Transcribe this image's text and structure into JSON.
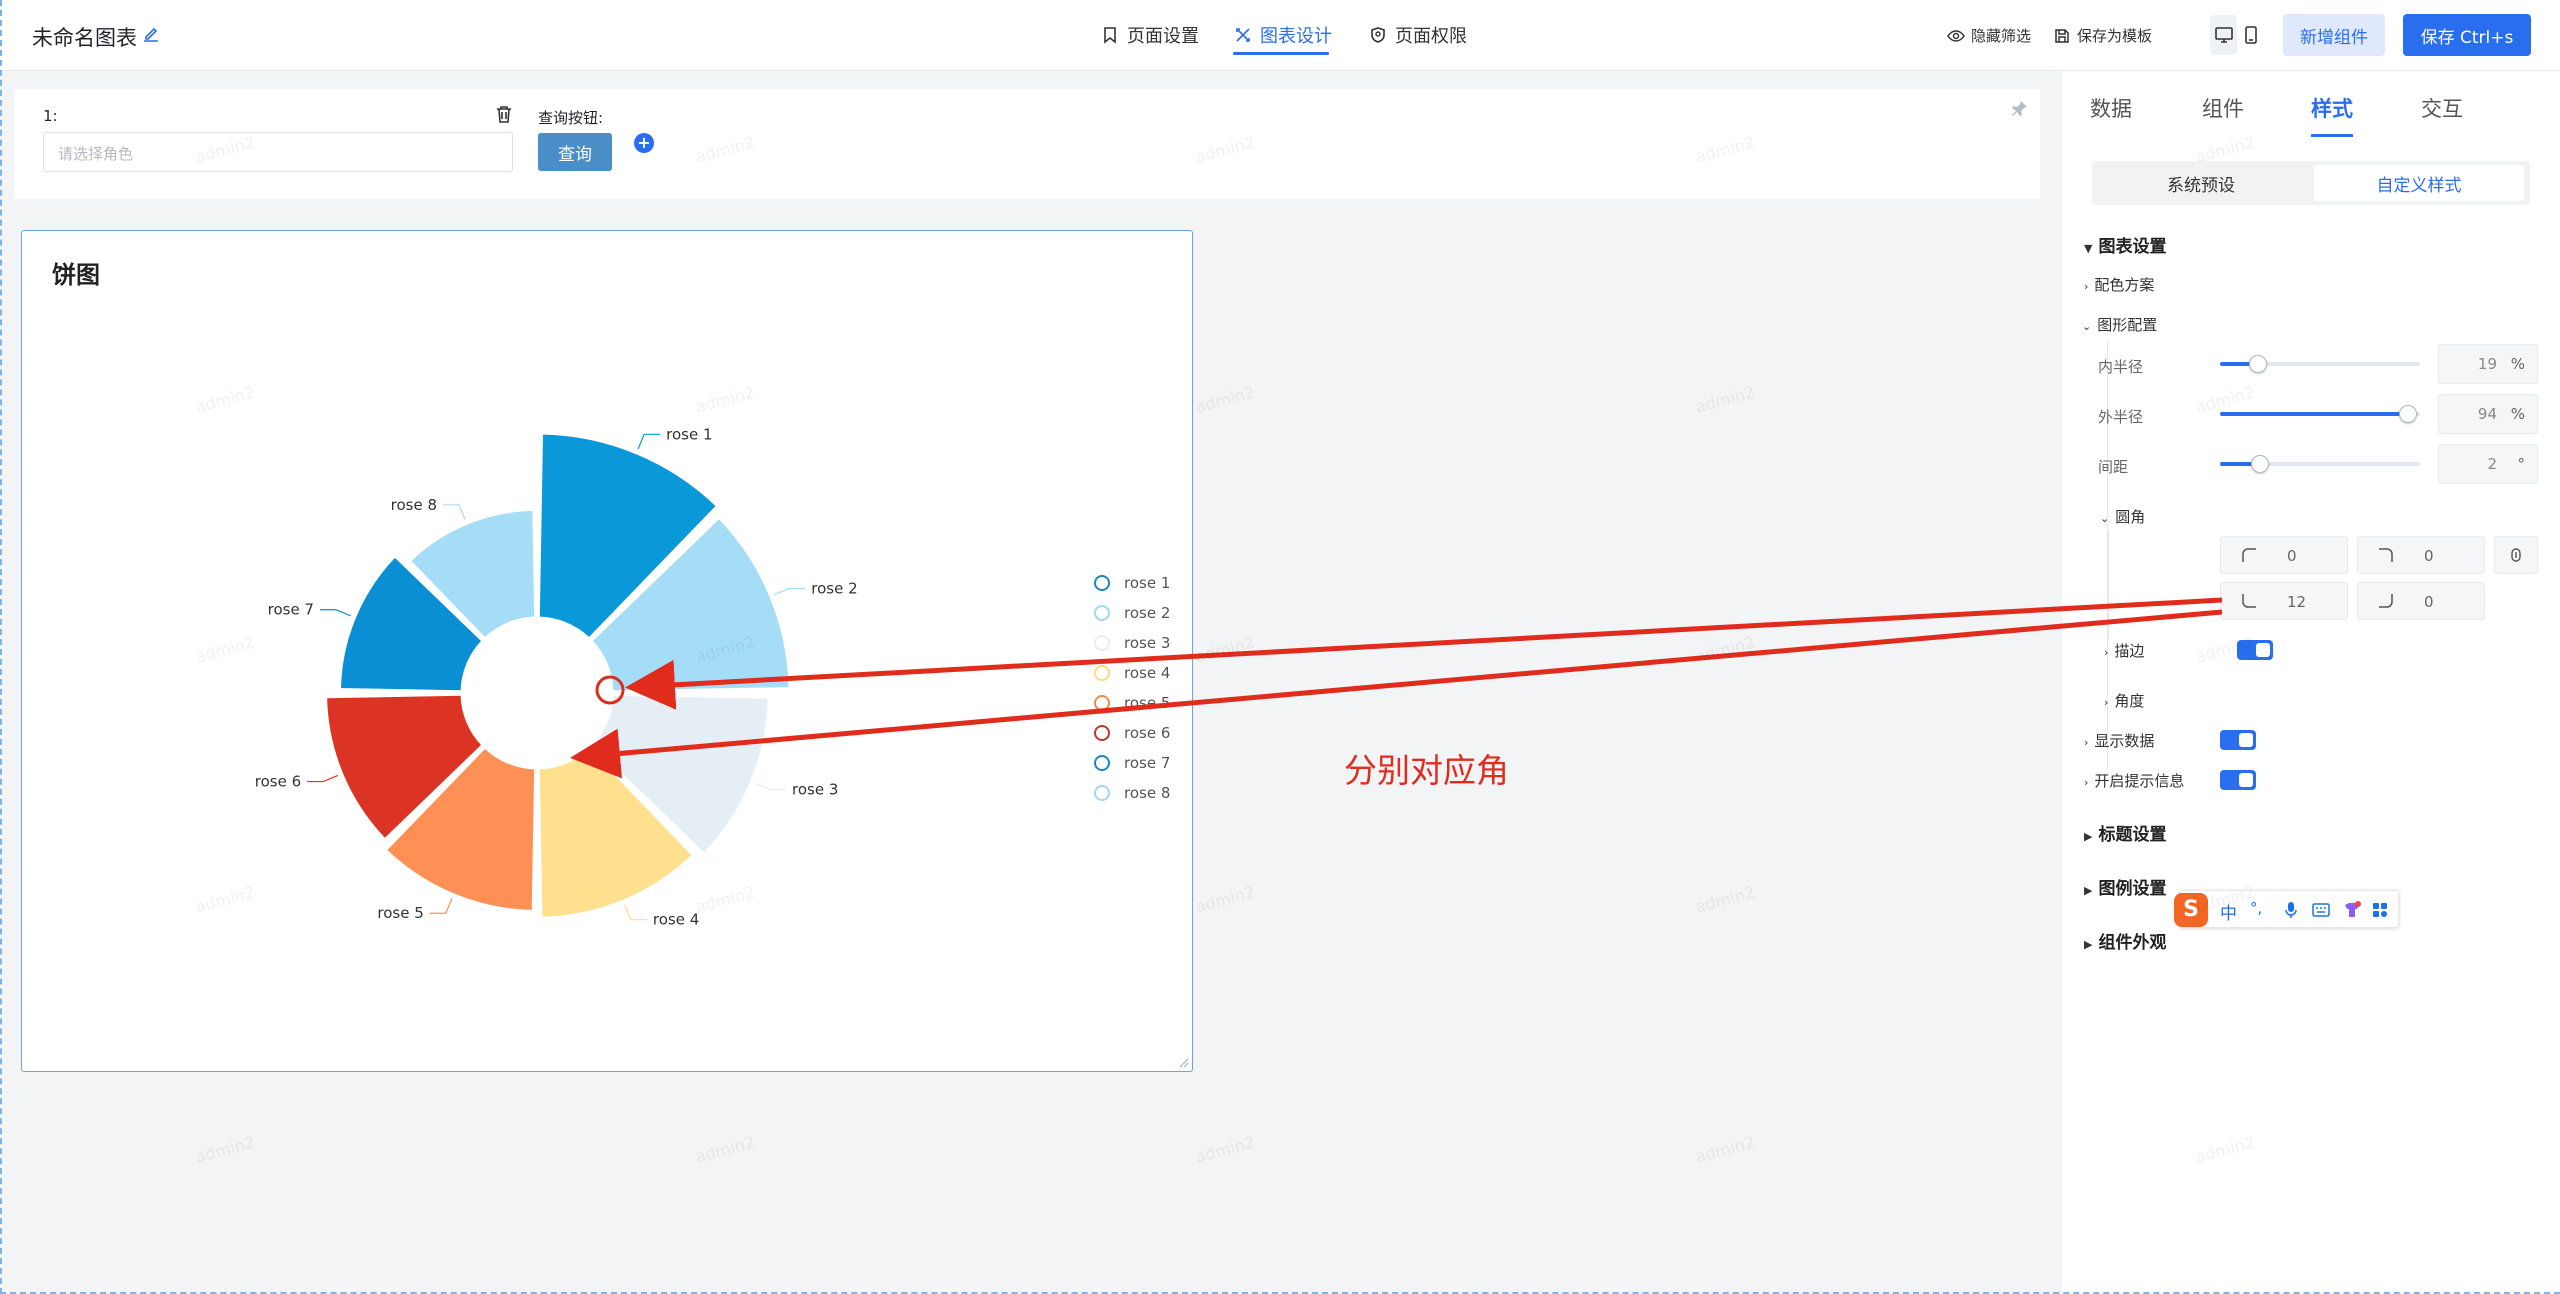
{
  "header": {
    "chart_name": "未命名图表",
    "nav_tabs": [
      {
        "label": "页面设置",
        "icon": "bookmark-icon",
        "active": false
      },
      {
        "label": "图表设计",
        "icon": "design-icon",
        "active": true
      },
      {
        "label": "页面权限",
        "icon": "shield-icon",
        "active": false
      }
    ],
    "hide_filter_label": "隐藏筛选",
    "save_template_label": "保存为模板",
    "add_component_label": "新增组件",
    "save_label": "保存 Ctrl+s",
    "accent_color": "#2a6ef0"
  },
  "filter": {
    "field_label": "1:",
    "field_placeholder": "请选择角色",
    "query_button_label": "查询按钮:",
    "query_button_text": "查询"
  },
  "card": {
    "title": "饼图"
  },
  "chart_data": {
    "type": "pie",
    "variant": "rose-donut",
    "categories": [
      "rose 1",
      "rose 2",
      "rose 3",
      "rose 4",
      "rose 5",
      "rose 6",
      "rose 7",
      "rose 8"
    ],
    "values": [
      40,
      38,
      32,
      30,
      28,
      26,
      22,
      18
    ],
    "colors": [
      "#0b98d8",
      "#a5ddf6",
      "#e6eef5",
      "#ffe08f",
      "#fe8f55",
      "#dc3424",
      "#0b8fd4",
      "#a5ddf6"
    ],
    "legend_ring_colors": [
      "#1a88b8",
      "#9fd8f0",
      "#e6eef5",
      "#ffd97a",
      "#f08a50",
      "#c0392b",
      "#1a88b8",
      "#9fd8f0"
    ],
    "inner_radius_pct": 19,
    "outer_radius_pct": 94,
    "pad_angle_deg": 2,
    "legend_position": "right"
  },
  "panel": {
    "tabs": [
      "数据",
      "组件",
      "样式",
      "交互"
    ],
    "active_tab": "样式",
    "segment": [
      "系统预设",
      "自定义样式"
    ],
    "chart_settings_title": "图表设置",
    "color_scheme_label": "配色方案",
    "shape_config_label": "图形配置",
    "inner_radius": {
      "label": "内半径",
      "value": "19",
      "unit": "%",
      "level": 0.19
    },
    "outer_radius": {
      "label": "外半径",
      "value": "94",
      "unit": "%",
      "level": 0.94
    },
    "spacing": {
      "label": "间距",
      "value": "2",
      "unit": "°",
      "level": 0.2
    },
    "corner_label": "圆角",
    "corners": [
      "0",
      "0",
      "12",
      "0"
    ],
    "stroke_label": "描边",
    "angle_label": "角度",
    "show_data_label": "显示数据",
    "tooltip_label": "开启提示信息",
    "title_settings": "标题设置",
    "legend_settings": "图例设置",
    "appearance_settings": "组件外观"
  },
  "annotation": {
    "text": "分别对应角",
    "color": "#e02b1d"
  },
  "ime": {
    "zh_label": "中",
    "punct_label": "°,"
  },
  "watermark": "admin2"
}
